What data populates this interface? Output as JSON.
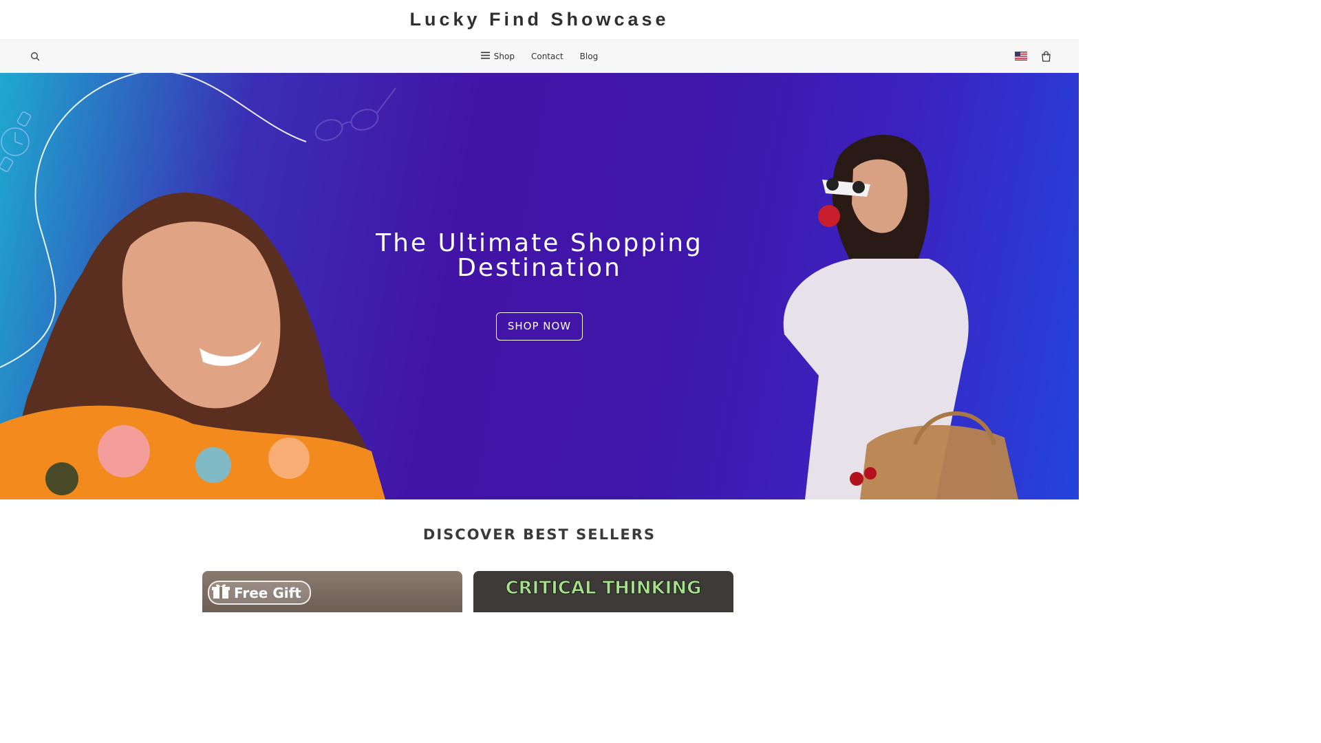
{
  "site": {
    "title": "Lucky Find Showcase"
  },
  "nav": {
    "items": [
      {
        "label": "Shop"
      },
      {
        "label": "Contact"
      },
      {
        "label": "Blog"
      }
    ],
    "icons": {
      "search": "search-icon",
      "menu": "hamburger-icon",
      "flag": "us-flag-icon",
      "cart": "shopping-bag-icon"
    }
  },
  "hero": {
    "title_line1": "The Ultimate Shopping",
    "title_line2": "Destination",
    "cta_label": "SHOP NOW"
  },
  "best_sellers": {
    "title": "DISCOVER BEST SELLERS",
    "cards": [
      {
        "badge": "Free Gift"
      },
      {
        "headline": "CRITICAL THINKING"
      }
    ]
  },
  "colors": {
    "hero_gradient_start": "#1fa9cf",
    "hero_gradient_mid": "#4214a6",
    "hero_gradient_end": "#2444dd",
    "navbar_bg": "#f7f7f7",
    "card_text_green": "#a6e08a"
  }
}
